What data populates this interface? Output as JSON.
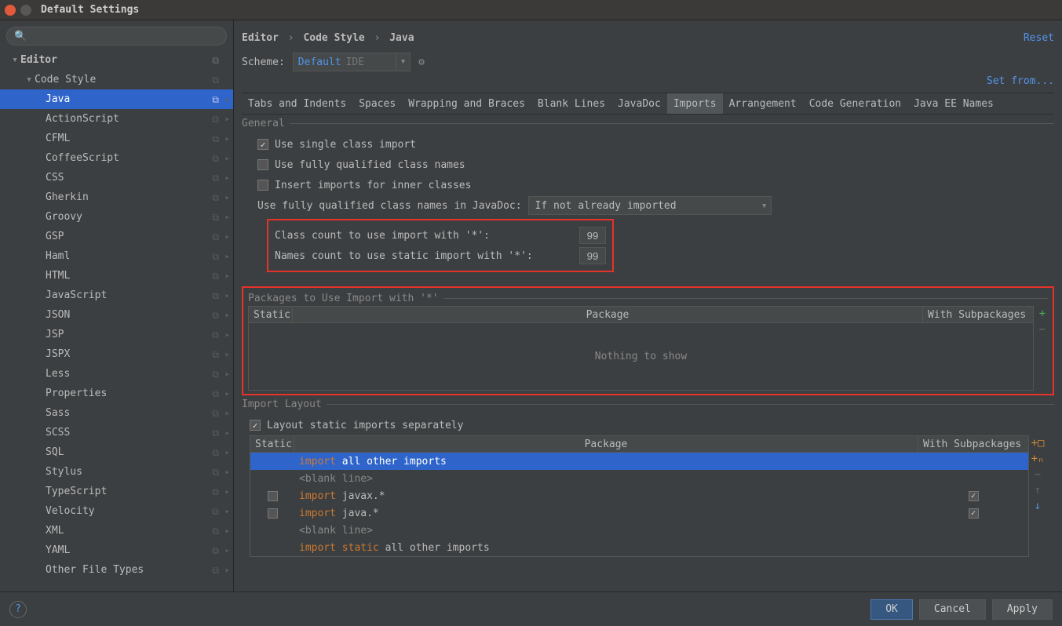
{
  "window": {
    "title": "Default Settings"
  },
  "breadcrumb": [
    "Editor",
    "Code Style",
    "Java"
  ],
  "links": {
    "reset": "Reset",
    "set_from": "Set from..."
  },
  "scheme": {
    "label": "Scheme:",
    "name": "Default",
    "tag": "IDE"
  },
  "tabs": [
    "Tabs and Indents",
    "Spaces",
    "Wrapping and Braces",
    "Blank Lines",
    "JavaDoc",
    "Imports",
    "Arrangement",
    "Code Generation",
    "Java EE Names"
  ],
  "active_tab": 5,
  "tree": {
    "editor": "Editor",
    "code_style": "Code Style",
    "items": [
      "Java",
      "ActionScript",
      "CFML",
      "CoffeeScript",
      "CSS",
      "Gherkin",
      "Groovy",
      "GSP",
      "Haml",
      "HTML",
      "JavaScript",
      "JSON",
      "JSP",
      "JSPX",
      "Less",
      "Properties",
      "Sass",
      "SCSS",
      "SQL",
      "Stylus",
      "TypeScript",
      "Velocity",
      "XML",
      "YAML",
      "Other File Types"
    ],
    "selected_index": 0
  },
  "general": {
    "title": "General",
    "use_single": {
      "label": "Use single class import",
      "checked": true
    },
    "use_fq": {
      "label": "Use fully qualified class names",
      "checked": false
    },
    "insert_inner": {
      "label": "Insert imports for inner classes",
      "checked": false
    },
    "fq_javadoc_label": "Use fully qualified class names in JavaDoc:",
    "fq_javadoc_value": "If not already imported",
    "class_count_label": "Class count to use import with '*':",
    "class_count_value": "99",
    "names_count_label": "Names count to use static import with '*':",
    "names_count_value": "99"
  },
  "packages_star": {
    "title": "Packages to Use Import with '*'",
    "cols": {
      "static": "Static",
      "package": "Package",
      "sub": "With Subpackages"
    },
    "empty": "Nothing to show"
  },
  "import_layout": {
    "title": "Import Layout",
    "layout_static": {
      "label": "Layout static imports separately",
      "checked": true
    },
    "cols": {
      "static": "Static",
      "package": "Package",
      "sub": "With Subpackages"
    },
    "rows": [
      {
        "type": "sel",
        "static": null,
        "text_pre": "import",
        "text": "all other imports",
        "sub": null
      },
      {
        "type": "blank",
        "text": "<blank line>"
      },
      {
        "type": "pkg",
        "static": false,
        "text_pre": "import",
        "text": "javax.*",
        "sub": true
      },
      {
        "type": "pkg",
        "static": false,
        "text_pre": "import",
        "text": "java.*",
        "sub": true
      },
      {
        "type": "blank",
        "text": "<blank line>"
      },
      {
        "type": "static",
        "static": null,
        "text_pre": "import",
        "text_pre2": "static",
        "text": "all other imports",
        "sub": null
      }
    ]
  },
  "footer": {
    "ok": "OK",
    "cancel": "Cancel",
    "apply": "Apply"
  }
}
